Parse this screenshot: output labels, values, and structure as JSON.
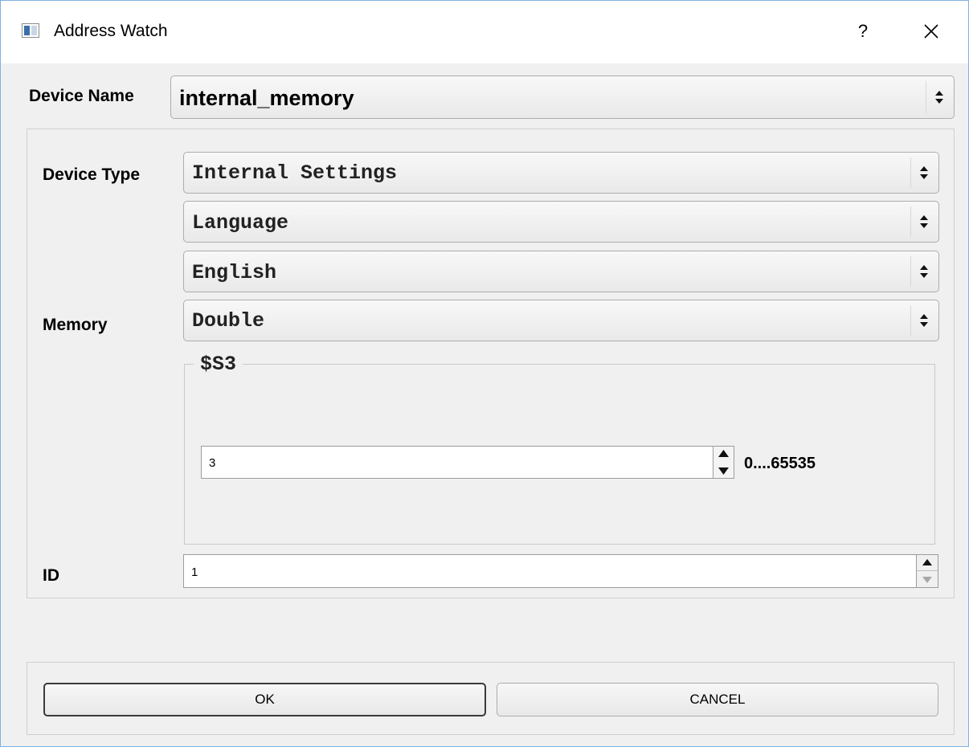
{
  "window": {
    "title": "Address Watch",
    "help_label": "?",
    "icons": {
      "app": "app-window-icon",
      "close": "close-icon"
    }
  },
  "device_name": {
    "label": "Device Name",
    "value": "internal_memory"
  },
  "device_type": {
    "label": "Device Type",
    "value": "Internal Settings"
  },
  "category_select": {
    "value": "Language"
  },
  "option_select": {
    "value": "English"
  },
  "memory": {
    "label": "Memory",
    "value": "Double"
  },
  "address_group": {
    "title": "$S3",
    "value": "3",
    "range": "0....65535"
  },
  "id_field": {
    "label": "ID",
    "value": "1"
  },
  "buttons": {
    "ok": "OK",
    "cancel": "CANCEL"
  }
}
